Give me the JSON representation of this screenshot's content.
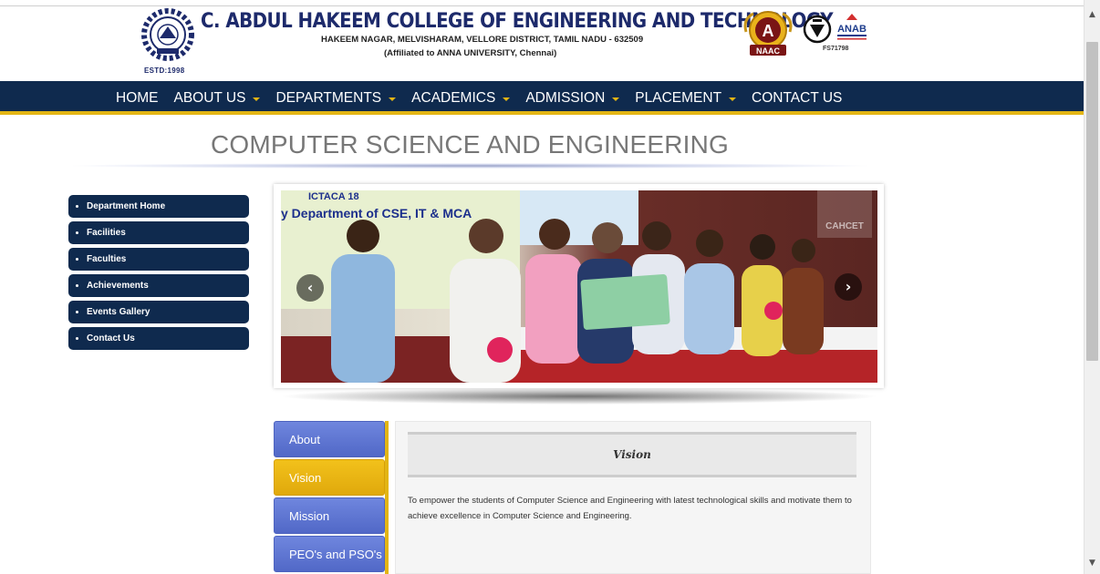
{
  "header": {
    "college_name": "C. ABDUL HAKEEM COLLEGE OF ENGINEERING AND TECHNOLOGY",
    "address": "HAKEEM NAGAR, MELVISHARAM, VELLORE DISTRICT, TAMIL NADU - 632509",
    "affiliation": "(Affiliated to ANNA UNIVERSITY, Chennai)",
    "estd": "ESTD:1998",
    "naac_grade": "A",
    "naac_label": "NAAC",
    "anab_label": "ANAB",
    "cert_code": "FS71798",
    "logo_icon": "college-gear-emblem-icon",
    "bis_icon": "bis-certification-icon"
  },
  "nav": {
    "items": [
      {
        "label": "HOME",
        "dropdown": false
      },
      {
        "label": "ABOUT US",
        "dropdown": true
      },
      {
        "label": "DEPARTMENTS",
        "dropdown": true
      },
      {
        "label": "ACADEMICS",
        "dropdown": true
      },
      {
        "label": "ADMISSION",
        "dropdown": true
      },
      {
        "label": "PLACEMENT",
        "dropdown": true
      },
      {
        "label": "CONTACT US",
        "dropdown": false
      }
    ]
  },
  "page": {
    "title": "COMPUTER SCIENCE AND ENGINEERING"
  },
  "side_menu": {
    "items": [
      {
        "label": "Department Home"
      },
      {
        "label": "Facilities"
      },
      {
        "label": "Faculties"
      },
      {
        "label": "Achievements"
      },
      {
        "label": "Events Gallery"
      },
      {
        "label": "Contact Us"
      }
    ]
  },
  "slider": {
    "banner_text": "ICTACA 18",
    "banner_subtitle": "y Department of CSE, IT & MCA",
    "watermark": "CAHCET",
    "prev_icon": "chevron-left-icon",
    "next_icon": "chevron-right-icon"
  },
  "tabs": {
    "items": [
      {
        "label": "About",
        "active": false
      },
      {
        "label": "Vision",
        "active": true
      },
      {
        "label": "Mission",
        "active": false
      },
      {
        "label": "PEO's and PSO's",
        "active": false
      }
    ]
  },
  "content": {
    "heading": "Vision",
    "text": "To empower the students of Computer Science and Engineering with latest technological skills and motivate them to achieve excellence in Computer Science and Engineering."
  },
  "colors": {
    "nav_bg": "#0f2a4e",
    "accent": "#e3b514",
    "tab_blue": "#5f77d4",
    "brand_text": "#1d2a6b"
  }
}
